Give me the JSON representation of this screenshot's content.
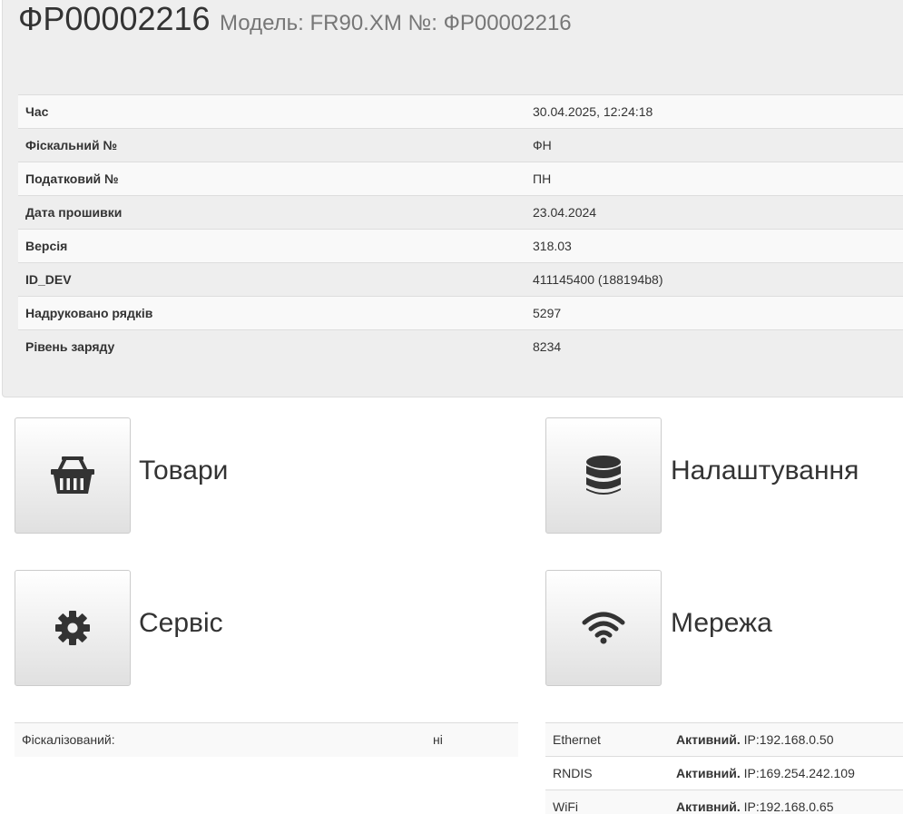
{
  "header": {
    "serial": "ФР00002216",
    "subtitle": "Модель: FR90.XM №: ФР00002216"
  },
  "info": {
    "rows": [
      {
        "label": "Час",
        "value": "30.04.2025, 12:24:18"
      },
      {
        "label": "Фіскальний №",
        "value": "ФН"
      },
      {
        "label": "Податковий №",
        "value": "ПН"
      },
      {
        "label": "Дата прошивки",
        "value": "23.04.2024"
      },
      {
        "label": "Версія",
        "value": "318.03"
      },
      {
        "label": "ID_DEV",
        "value": "411145400 (188194b8)"
      },
      {
        "label": "Надруковано рядків",
        "value": "5297"
      },
      {
        "label": "Рівень заряду",
        "value": "8234"
      }
    ]
  },
  "tiles": {
    "goods": {
      "label": "Товари",
      "icon": "basket-icon"
    },
    "settings": {
      "label": "Налаштування",
      "icon": "database-icon"
    },
    "service": {
      "label": "Сервіс",
      "icon": "gear-icon"
    },
    "network": {
      "label": "Мережа",
      "icon": "wifi-icon"
    }
  },
  "fiscal": {
    "label": "Фіскалізований:",
    "value": "ні"
  },
  "network_status": {
    "rows": [
      {
        "name": "Ethernet",
        "status": "Активний.",
        "ip": "IP:192.168.0.50"
      },
      {
        "name": "RNDIS",
        "status": "Активний.",
        "ip": "IP:169.254.242.109"
      },
      {
        "name": "WiFi",
        "status": "Активний.",
        "ip": "IP:192.168.0.65"
      }
    ]
  },
  "colors": {
    "header_bg": "#eeeeee",
    "text": "#333333",
    "muted": "#777777",
    "icon": "#333333"
  }
}
